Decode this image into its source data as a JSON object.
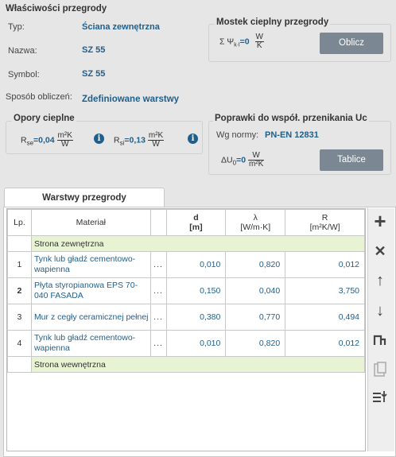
{
  "properties": {
    "title": "Właściwości przegrody",
    "typ_label": "Typ:",
    "typ_value": "Ściana zewnętrzna",
    "nazwa_label": "Nazwa:",
    "nazwa_value": "SZ 55",
    "symbol_label": "Symbol:",
    "symbol_value": "SZ 55",
    "sposob_label": "Sposób obliczeń:",
    "sposob_value": "Zdefiniowane warstwy"
  },
  "bridge": {
    "title": "Mostek cieplny przegrody",
    "sum_prefix": "Σ Ψ",
    "sum_sub": "k",
    "sum_sub2": "l",
    "sum_eq": "k",
    "sum_value": "=0",
    "unit_num": "W",
    "unit_den": "K",
    "button": "Oblicz"
  },
  "resistance": {
    "title": "Opory cieplne",
    "rse_label": "R",
    "rse_sub": "se",
    "rse_value": "=0,04",
    "rsi_label": "R",
    "rsi_sub": "si",
    "rsi_value": "=0,13",
    "unit_num": "m²K",
    "unit_den": "W",
    "info_glyph": "i"
  },
  "corrections": {
    "title": "Poprawki do współ. przenikania Uc",
    "norm_label": "Wg normy:",
    "norm_value": "PN-EN 12831",
    "du_label": "ΔU",
    "du_sub": "0",
    "du_value": "=0",
    "unit_num": "W",
    "unit_den": "m²K",
    "button": "Tablice"
  },
  "tab": {
    "label": "Warstwy przegrody"
  },
  "table": {
    "headers": {
      "lp": "Lp.",
      "material": "Materiał",
      "d_sym": "d",
      "d_unit": "[m]",
      "lambda_sym": "λ",
      "lambda_unit": "[W/m·K]",
      "r_sym": "R",
      "r_unit": "[m²K/W]"
    },
    "outer_side": "Strona zewnętrzna",
    "inner_side": "Strona wewnętrzna",
    "dots": "...",
    "rows": [
      {
        "lp": "1",
        "material": "Tynk lub gładź cementowo-wapienna",
        "d": "0,010",
        "lambda": "0,820",
        "r": "0,012"
      },
      {
        "lp": "2",
        "material": "Płyta styropianowa EPS 70-040 FASADA",
        "d": "0,150",
        "lambda": "0,040",
        "r": "3,750"
      },
      {
        "lp": "3",
        "material": "Mur z cegły ceramicznej pełnej",
        "d": "0,380",
        "lambda": "0,770",
        "r": "0,494"
      },
      {
        "lp": "4",
        "material": "Tynk lub gładź cementowo-wapienna",
        "d": "0,010",
        "lambda": "0,820",
        "r": "0,012"
      }
    ]
  },
  "side_buttons": {
    "add": "+",
    "remove": "✕",
    "up": "↑",
    "down": "↓"
  }
}
